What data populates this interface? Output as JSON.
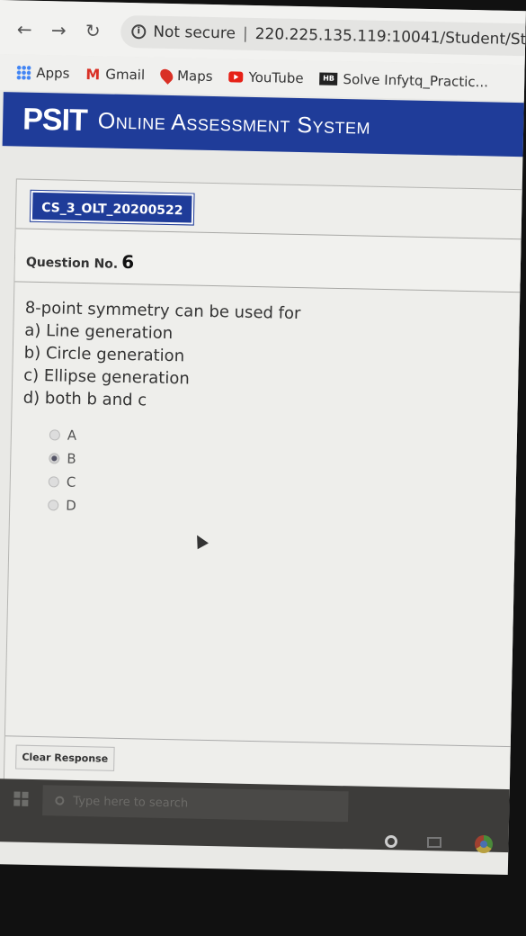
{
  "browser": {
    "security_label": "Not secure",
    "url": "220.225.135.119:10041/Student/Studen",
    "bookmarks": [
      {
        "label": "Apps",
        "icon": "apps-icon"
      },
      {
        "label": "Gmail",
        "icon": "gmail-icon"
      },
      {
        "label": "Maps",
        "icon": "maps-icon"
      },
      {
        "label": "YouTube",
        "icon": "youtube-icon"
      },
      {
        "label": "Solve Infytq_Practic...",
        "icon": "hackerblocks-icon"
      }
    ]
  },
  "app": {
    "brand": "PSIT",
    "system_name": "Online Assessment System",
    "test_code": "CS_3_OLT_20200522"
  },
  "question": {
    "number_label": "Question No.",
    "number": "6",
    "text": "8-point symmetry can be used for\na) Line generation\nb) Circle generation\nc) Ellipse generation\nd) both b and c",
    "options": [
      "A",
      "B",
      "C",
      "D"
    ],
    "selected": "B"
  },
  "actions": {
    "clear_label": "Clear Response"
  },
  "taskbar": {
    "search_placeholder": "Type here to search",
    "search_icon_text": "⚲"
  }
}
